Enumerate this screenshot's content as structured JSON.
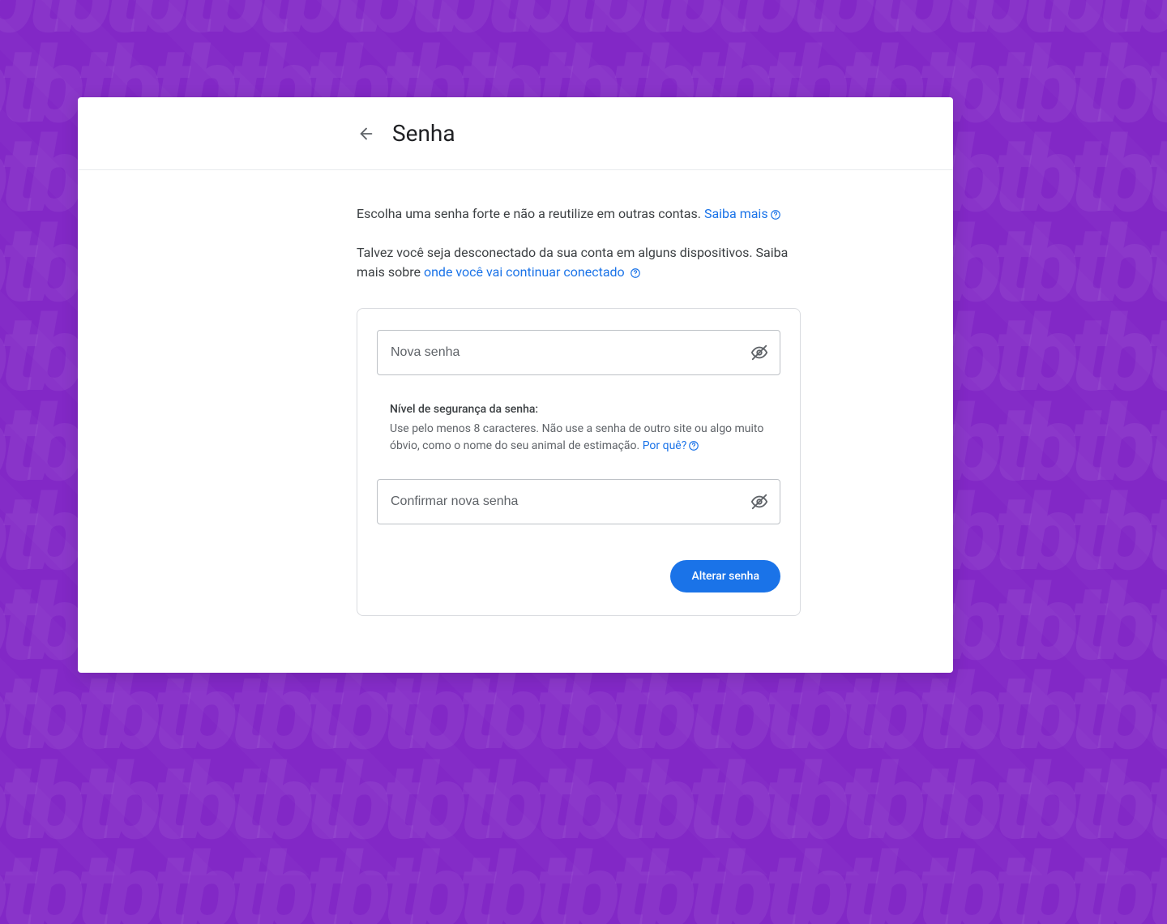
{
  "header": {
    "title": "Senha"
  },
  "intro": {
    "line1_prefix": "Escolha uma senha forte e não a reutilize em outras contas. ",
    "learn_more_label": "Saiba mais",
    "line2_prefix": "Talvez você seja desconectado da sua conta em alguns dispositivos. Saiba mais sobre ",
    "stay_signed_link": "onde você vai continuar conectado"
  },
  "form": {
    "new_password_placeholder": "Nova senha",
    "confirm_password_placeholder": "Confirmar nova senha",
    "strength_title": "Nível de segurança da senha:",
    "strength_desc_prefix": "Use pelo menos 8 caracteres. Não use a senha de outro site ou algo muito óbvio, como o nome do seu animal de estimação. ",
    "why_link": "Por quê?",
    "submit_label": "Alterar senha"
  }
}
